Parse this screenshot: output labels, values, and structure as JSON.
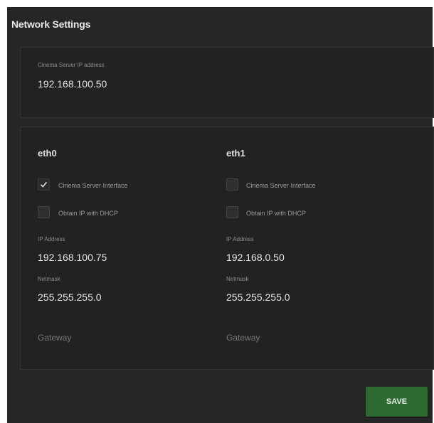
{
  "title": "Network Settings",
  "server": {
    "label": "Cinema Server IP address",
    "value": "192.168.100.50"
  },
  "interfaces": [
    {
      "name": "eth0",
      "cinema_interface": {
        "label": "Cinema Server Interface",
        "checked": true
      },
      "dhcp": {
        "label": "Obtain IP with DHCP",
        "checked": false
      },
      "ip_label": "IP Address",
      "ip": "192.168.100.75",
      "netmask_label": "Netmask",
      "netmask": "255.255.255.0",
      "gateway_placeholder": "Gateway"
    },
    {
      "name": "eth1",
      "cinema_interface": {
        "label": "Cinema Server Interface",
        "checked": false
      },
      "dhcp": {
        "label": "Obtain IP with DHCP",
        "checked": false
      },
      "ip_label": "IP Address",
      "ip": "192.168.0.50",
      "netmask_label": "Netmask",
      "netmask": "255.255.255.0",
      "gateway_placeholder": "Gateway"
    }
  ],
  "save_label": "SAVE",
  "colors": {
    "background": "#262626",
    "card": "#222222",
    "accent": "#2f6a32"
  }
}
